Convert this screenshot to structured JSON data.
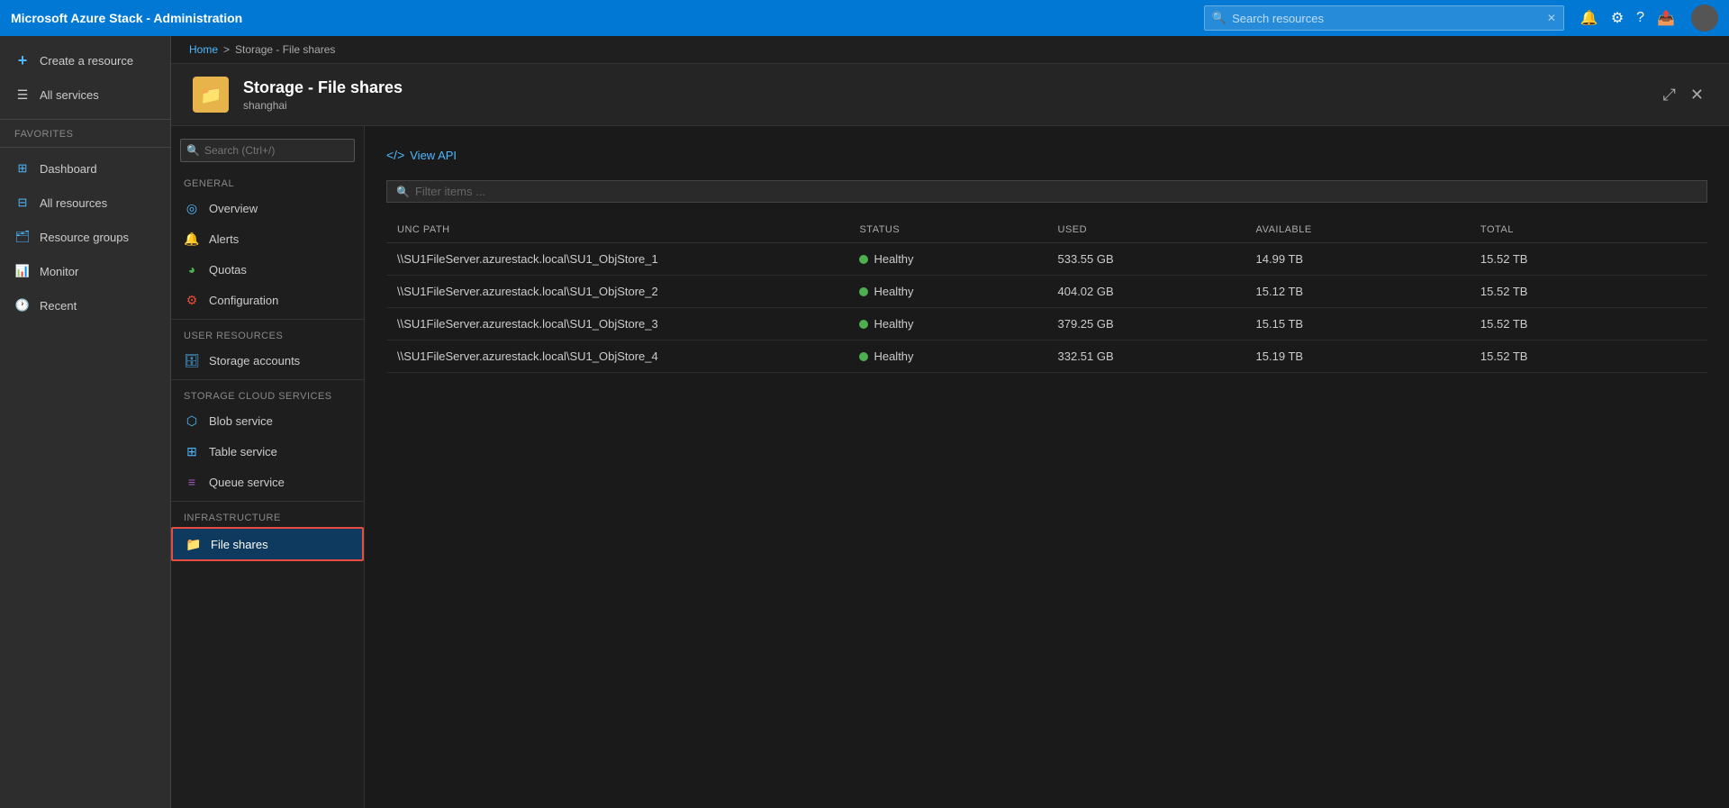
{
  "app": {
    "title": "Microsoft Azure Stack - Administration"
  },
  "topbar": {
    "search_placeholder": "Search resources",
    "close_icon": "✕"
  },
  "sidebar": {
    "create_resource": "Create a resource",
    "all_services": "All services",
    "favorites_label": "FAVORITES",
    "items": [
      {
        "id": "dashboard",
        "label": "Dashboard"
      },
      {
        "id": "all-resources",
        "label": "All resources"
      },
      {
        "id": "resource-groups",
        "label": "Resource groups"
      },
      {
        "id": "monitor",
        "label": "Monitor"
      },
      {
        "id": "recent",
        "label": "Recent"
      }
    ]
  },
  "breadcrumb": {
    "home": "Home",
    "separator": ">",
    "current": "Storage - File shares"
  },
  "resource": {
    "title": "Storage - File shares",
    "subtitle": "shanghai"
  },
  "left_nav": {
    "search_placeholder": "Search (Ctrl+/)",
    "general_label": "GENERAL",
    "general_items": [
      {
        "id": "overview",
        "label": "Overview"
      },
      {
        "id": "alerts",
        "label": "Alerts"
      },
      {
        "id": "quotas",
        "label": "Quotas"
      },
      {
        "id": "configuration",
        "label": "Configuration"
      }
    ],
    "user_resources_label": "USER RESOURCES",
    "user_resources_items": [
      {
        "id": "storage-accounts",
        "label": "Storage accounts"
      }
    ],
    "storage_cloud_label": "STORAGE CLOUD SERVICES",
    "storage_cloud_items": [
      {
        "id": "blob-service",
        "label": "Blob service"
      },
      {
        "id": "table-service",
        "label": "Table service"
      },
      {
        "id": "queue-service",
        "label": "Queue service"
      }
    ],
    "infrastructure_label": "INFRASTRUCTURE",
    "infrastructure_items": [
      {
        "id": "file-shares",
        "label": "File shares",
        "active": true
      }
    ]
  },
  "main": {
    "view_api_btn": "View API",
    "filter_placeholder": "Filter items ...",
    "table": {
      "columns": [
        {
          "id": "unc-path",
          "label": "UNC PATH"
        },
        {
          "id": "status",
          "label": "STATUS"
        },
        {
          "id": "used",
          "label": "USED"
        },
        {
          "id": "available",
          "label": "AVAILABLE"
        },
        {
          "id": "total",
          "label": "TOTAL"
        }
      ],
      "rows": [
        {
          "unc_path": "\\\\SU1FileServer.azurestack.local\\SU1_ObjStore_1",
          "status": "Healthy",
          "used": "533.55 GB",
          "available": "14.99 TB",
          "total": "15.52 TB"
        },
        {
          "unc_path": "\\\\SU1FileServer.azurestack.local\\SU1_ObjStore_2",
          "status": "Healthy",
          "used": "404.02 GB",
          "available": "15.12 TB",
          "total": "15.52 TB"
        },
        {
          "unc_path": "\\\\SU1FileServer.azurestack.local\\SU1_ObjStore_3",
          "status": "Healthy",
          "used": "379.25 GB",
          "available": "15.15 TB",
          "total": "15.52 TB"
        },
        {
          "unc_path": "\\\\SU1FileServer.azurestack.local\\SU1_ObjStore_4",
          "status": "Healthy",
          "used": "332.51 GB",
          "available": "15.19 TB",
          "total": "15.52 TB"
        }
      ]
    }
  }
}
